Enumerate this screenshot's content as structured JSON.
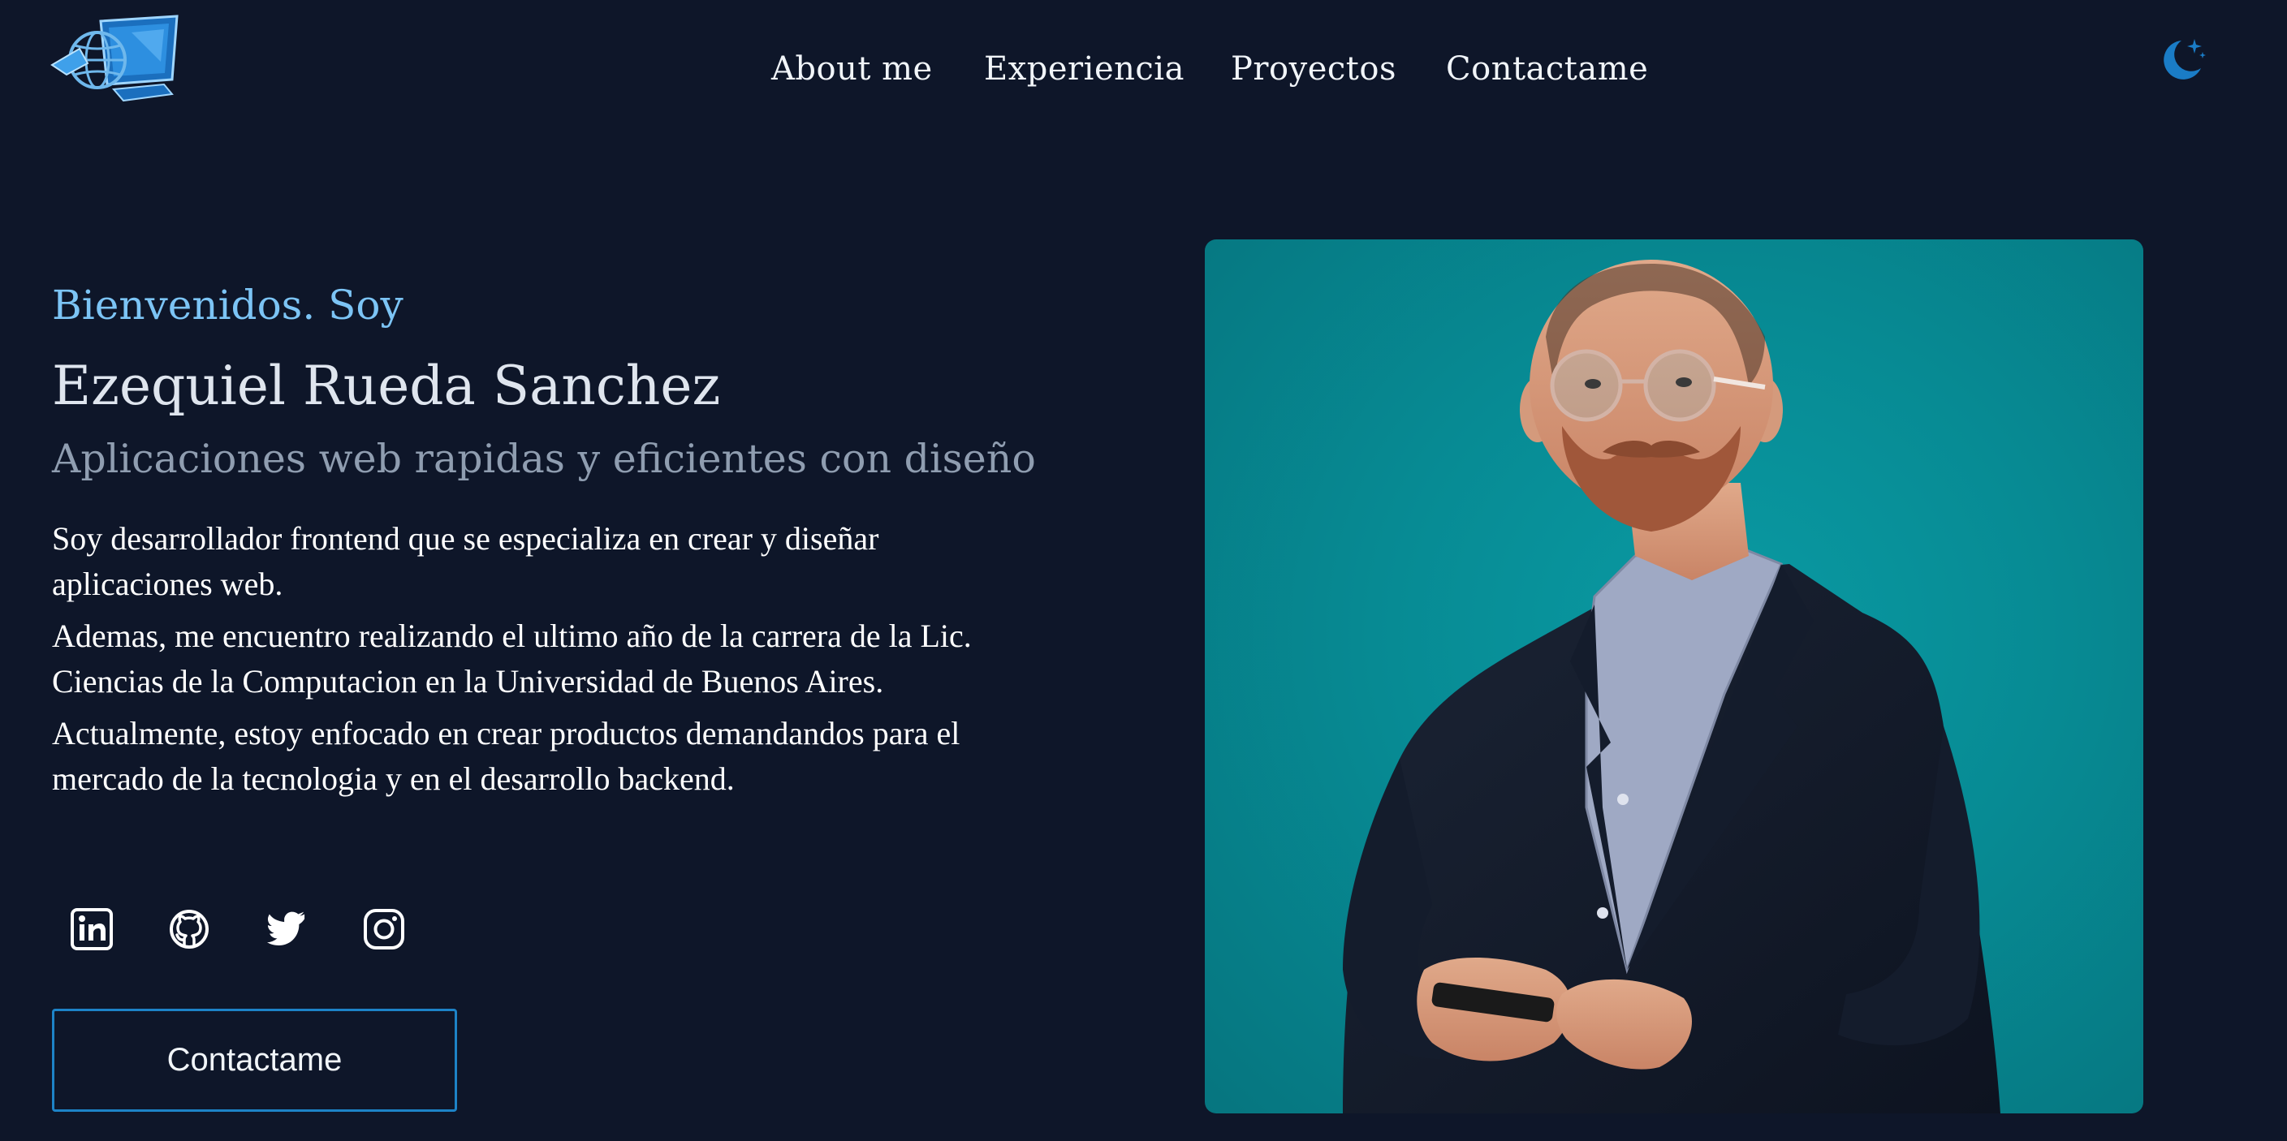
{
  "nav": {
    "items": [
      {
        "label": "About me"
      },
      {
        "label": "Experiencia"
      },
      {
        "label": "Proyectos"
      },
      {
        "label": "Contactame"
      }
    ]
  },
  "hero": {
    "greeting": "Bienvenidos. Soy",
    "name": "Ezequiel Rueda Sanchez",
    "tagline": "Aplicaciones web rapidas y eficientes con diseño",
    "bio": [
      "Soy desarrollador frontend que se especializa en crear y diseñar aplicaciones web.",
      "Ademas, me encuentro realizando el ultimo año de la carrera de la Lic. Ciencias de la Computacion en la Universidad de Buenos Aires.",
      "Actualmente, estoy enfocado en crear productos demandandos para el mercado de la tecnologia y en el desarrollo backend."
    ],
    "cta_label": "Contactame"
  },
  "socials": [
    {
      "icon": "linkedin-icon"
    },
    {
      "icon": "github-icon"
    },
    {
      "icon": "twitter-icon"
    },
    {
      "icon": "instagram-icon"
    }
  ],
  "icons": {
    "logo": "logo-globe-monitor-icon",
    "theme": "moon-stars-icon"
  },
  "colors": {
    "background": "#0e1629",
    "accent": "#1d83c7",
    "greeting": "#7cc4f5",
    "photo_background": "#078b94"
  }
}
